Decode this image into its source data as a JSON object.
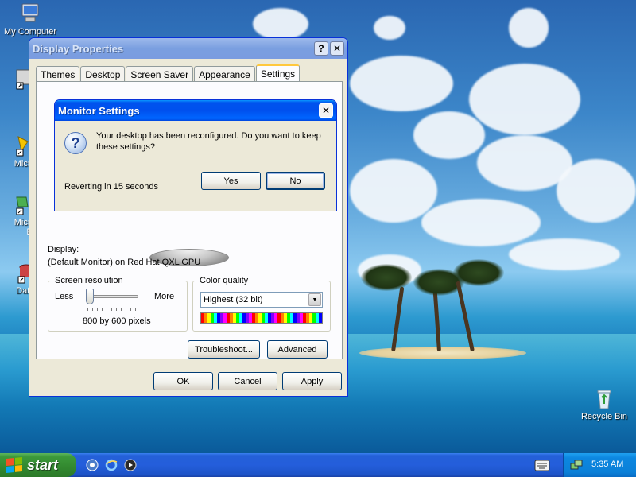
{
  "desktop": {
    "icons": [
      {
        "label": "My Computer"
      },
      {
        "label": "M"
      },
      {
        "label": "Microso"
      },
      {
        "label": "C+"
      },
      {
        "label": "Microso"
      },
      {
        "label": "Bas"
      },
      {
        "label": "DataW"
      },
      {
        "label": "Recycle Bin"
      }
    ]
  },
  "display_properties": {
    "title": "Display Properties",
    "help_glyph": "?",
    "close_glyph": "✕",
    "tabs": [
      {
        "label": "Themes"
      },
      {
        "label": "Desktop"
      },
      {
        "label": "Screen Saver"
      },
      {
        "label": "Appearance"
      },
      {
        "label": "Settings",
        "selected": true
      }
    ],
    "display_label": "Display:",
    "display_value": "(Default Monitor) on Red Hat QXL GPU",
    "resolution": {
      "legend": "Screen resolution",
      "less_label": "Less",
      "more_label": "More",
      "value_text": "800 by 600 pixels",
      "slider_fraction": 0.0
    },
    "color_quality": {
      "legend": "Color quality",
      "selected": "Highest (32 bit)"
    },
    "troubleshoot_label": "Troubleshoot...",
    "advanced_label": "Advanced",
    "ok_label": "OK",
    "cancel_label": "Cancel",
    "apply_label": "Apply"
  },
  "monitor_settings": {
    "title": "Monitor Settings",
    "close_glyph": "✕",
    "message": "Your desktop has been reconfigured.  Do you want to keep these settings?",
    "countdown": "Reverting in 15 seconds",
    "yes_label": "Yes",
    "no_label": "No",
    "icon_glyph": "?"
  },
  "taskbar": {
    "start_label": "start",
    "clock": "5:35 AM"
  },
  "colors": {
    "title_active": "#0053ee",
    "title_inactive": "#7a9fe0",
    "dialog_face": "#ece9d8",
    "taskbar": "#245edb",
    "start_green": "#32882f"
  }
}
